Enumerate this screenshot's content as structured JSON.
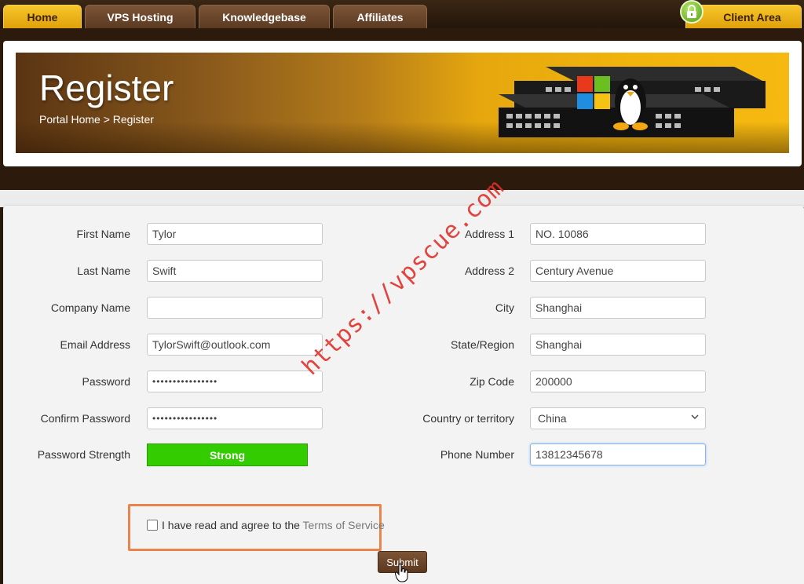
{
  "nav": {
    "tabs": [
      {
        "label": "Home",
        "active": true
      },
      {
        "label": "VPS Hosting",
        "active": false
      },
      {
        "label": "Knowledgebase",
        "active": false
      },
      {
        "label": "Affiliates",
        "active": false
      }
    ],
    "client_area": {
      "label": "Client Area",
      "icon": "lock-icon",
      "active": true
    }
  },
  "banner": {
    "title": "Register",
    "breadcrumb": "Portal Home > Register"
  },
  "form": {
    "left": {
      "first_name": {
        "label": "First Name",
        "value": "Tylor"
      },
      "last_name": {
        "label": "Last Name",
        "value": "Swift"
      },
      "company_name": {
        "label": "Company Name",
        "value": ""
      },
      "email": {
        "label": "Email Address",
        "value": "TylorSwift@outlook.com"
      },
      "password": {
        "label": "Password",
        "value": "••••••••••••••••"
      },
      "confirm_password": {
        "label": "Confirm Password",
        "value": "••••••••••••••••"
      },
      "password_strength": {
        "label": "Password Strength",
        "value": "Strong",
        "color": "#33cc00"
      }
    },
    "right": {
      "address1": {
        "label": "Address 1",
        "value": "NO. 10086"
      },
      "address2": {
        "label": "Address 2",
        "value": "Century Avenue"
      },
      "city": {
        "label": "City",
        "value": "Shanghai"
      },
      "state": {
        "label": "State/Region",
        "value": "Shanghai"
      },
      "zip": {
        "label": "Zip Code",
        "value": "200000"
      },
      "country": {
        "label": "Country or territory",
        "value": "China"
      },
      "phone": {
        "label": "Phone Number",
        "value": "13812345678"
      }
    },
    "tos": {
      "text": "I have read and agree to the ",
      "link": "Terms of Service",
      "checked": false
    },
    "submit_label": "Submit"
  },
  "watermark": "https://vpscue.com",
  "colors": {
    "accent": "#f1b40c",
    "nav_bg": "#2c1a0c",
    "button": "#6b4428",
    "highlight_box": "#e9854a"
  }
}
